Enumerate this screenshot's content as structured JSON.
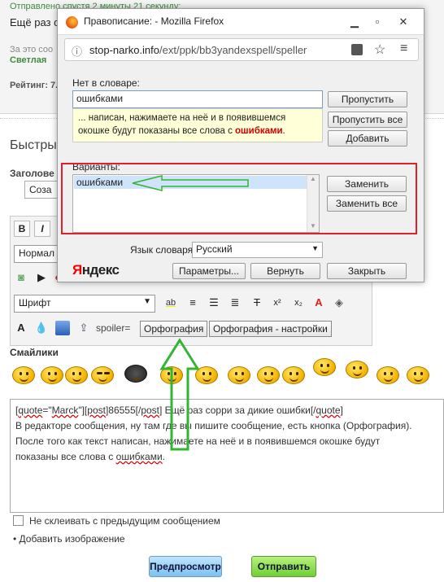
{
  "post": {
    "sent_line": "Отправлено спустя 2 минуты 21 секунду:",
    "text": "Ещё раз со",
    "rep_line": "За это соо",
    "author": "Светлая",
    "rating": "Рейтинг: 7."
  },
  "quick_reply": {
    "title": "Быстры",
    "subject_label": "Заголове",
    "subject_value": "Соза"
  },
  "editor": {
    "bold": "B",
    "italic": "I",
    "format_select": "Нормал",
    "font_select": "Шрифт",
    "spoiler_label": "spoiler=",
    "spell_button": "Орфография",
    "spell_settings_button": "Орфография - настройки"
  },
  "smileys_label": "Смайлики",
  "message": {
    "line1_prefix": "[",
    "line1_quote": "quote",
    "line1_eq": "=\"",
    "line1_marck": "Marck",
    "line1_mid": "\"][",
    "line1_post": "post",
    "line1_num": "]86555[/",
    "line1_post2": "post",
    "line1_rest": "] Ещё раз сорри за дикие ошибки[/",
    "line1_quote2": "quote",
    "line1_end": "]",
    "line2": "В редакторе сообщения, ну там где вы пишите сообщение, есть кнопка (Орфография).",
    "line3": "После того как текст написан, нажимаете на неё и в появившемся окошке будут",
    "line4_prefix": "показаны все слова с ",
    "line4_err": "ошибками",
    "line4_end": "."
  },
  "no_merge_label": "Не склеивать с предыдущим сообщением",
  "add_image": "• Добавить изображение",
  "buttons": {
    "preview": "Предпросмотр",
    "send": "Отправить"
  },
  "firefox": {
    "title": "Правописание: - Mozilla Firefox",
    "url_host": "stop-narko.info",
    "url_path": "/ext/ppk/bb3yandexspell/speller"
  },
  "speller": {
    "not_in_dict_label": "Нет в словаре:",
    "word": "ошибками",
    "context_prefix": "... написан, нажимаете на неё и в появившемся окошке будут показаны все слова с ",
    "context_word": "ошибками",
    "context_suffix": ".",
    "skip": "Пропустить",
    "skip_all": "Пропустить все",
    "add": "Добавить",
    "variants_label": "Варианты:",
    "variant_1": "ошибками",
    "replace": "Заменить",
    "replace_all": "Заменить все",
    "lang_label": "Язык словаря:",
    "lang_value": "Русский",
    "params": "Параметры...",
    "undo": "Вернуть",
    "close": "Закрыть",
    "yandex_y": "Я",
    "yandex_rest": "ндекс"
  },
  "colors": {
    "highlight_red": "#e0202a",
    "arrow_green": "#33b533",
    "selection": "#cfe3fb"
  }
}
